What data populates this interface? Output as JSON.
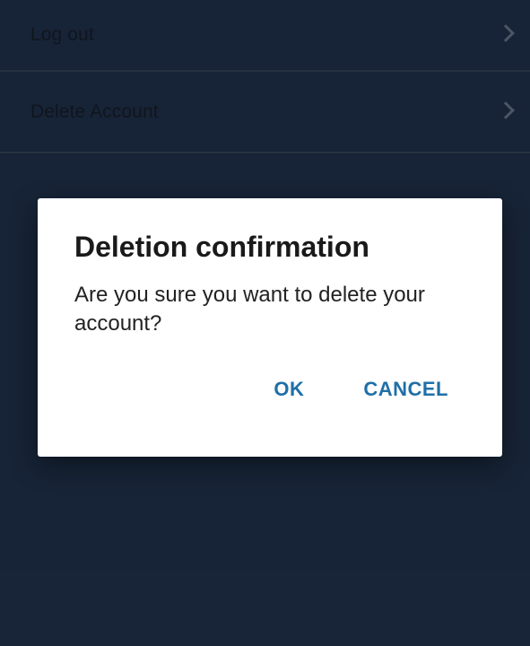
{
  "settings": {
    "items": [
      {
        "label": "Log out",
        "icon": "chevron-right-icon"
      },
      {
        "label": "Delete Account",
        "icon": "chevron-right-icon"
      }
    ]
  },
  "dialog": {
    "title": "Deletion confirmation",
    "message": "Are you sure you want to delete your account?",
    "ok_label": "OK",
    "cancel_label": "CANCEL"
  },
  "colors": {
    "background": "#263a5a",
    "accent": "#1f6fa8"
  }
}
